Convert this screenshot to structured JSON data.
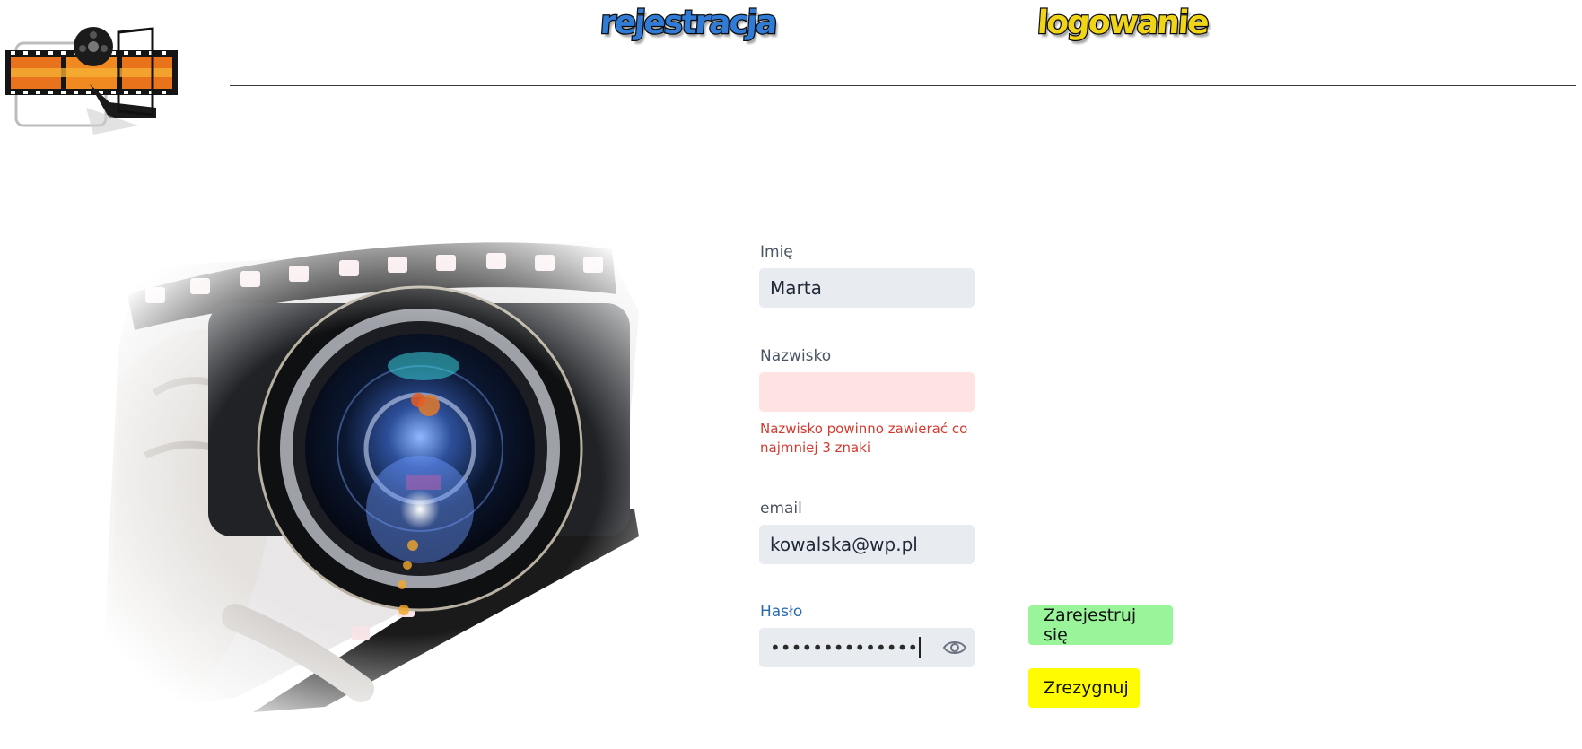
{
  "nav": {
    "register_label": "rejestracja",
    "login_label": "logowanie"
  },
  "form": {
    "first_name": {
      "label": "Imię",
      "value": "Marta"
    },
    "last_name": {
      "label": "Nazwisko",
      "value": "",
      "error": "Nazwisko powinno zawierać co najmniej 3 znaki"
    },
    "email": {
      "label": "email",
      "value": "kowalska@wp.pl"
    },
    "password": {
      "label": "Hasło",
      "masked_value": "••••••••••••••"
    }
  },
  "buttons": {
    "register_label": "Zarejestruj się",
    "cancel_label": "Zrezygnuj"
  },
  "colors": {
    "register_button": "#9af59a",
    "cancel_button": "#fffb00",
    "error_text": "#d43a2f",
    "focused_label": "#2b6cb0",
    "nav_register": "#2f7bd6",
    "nav_login": "#f0d416"
  },
  "icons": {
    "logo": "film-projector-logo-icon",
    "password_toggle": "eye-icon"
  }
}
